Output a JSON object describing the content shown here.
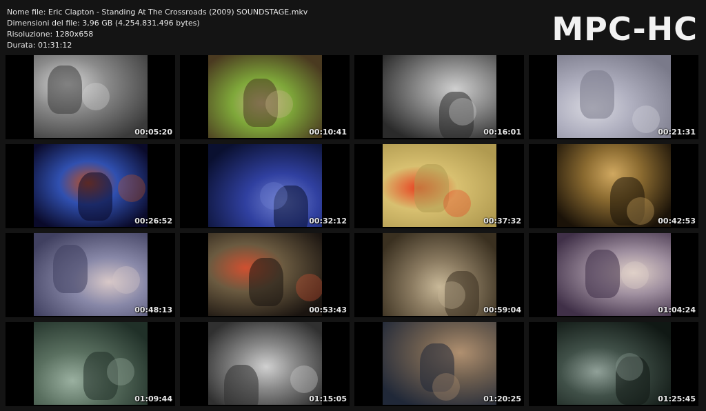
{
  "file_info": {
    "name_line": "Nome file: Eric Clapton - Standing At The Crossroads (2009) SOUNDSTAGE.mkv",
    "size_line": "Dimensioni del file: 3,96 GB (4.254.831.496 bytes)",
    "resolution_line": "Risoluzione: 1280x658",
    "duration_line": "Durata: 01:31:12"
  },
  "logo": "MPC-HC",
  "thumbnails": [
    {
      "time": "00:05:20",
      "colors": [
        "#3a3a3a",
        "#8a8a8a",
        "#d8d8d8"
      ]
    },
    {
      "time": "00:10:41",
      "colors": [
        "#4a3a20",
        "#7fa83a",
        "#c9b48a"
      ]
    },
    {
      "time": "00:16:01",
      "colors": [
        "#2a2a2a",
        "#8c8c8c",
        "#cfcfcf"
      ]
    },
    {
      "time": "00:21:31",
      "colors": [
        "#7a7a8a",
        "#b0b0c0",
        "#d8d8e0"
      ]
    },
    {
      "time": "00:26:52",
      "colors": [
        "#0a0a2a",
        "#3050b0",
        "#c05020"
      ]
    },
    {
      "time": "00:32:12",
      "colors": [
        "#0a1030",
        "#3040a0",
        "#7080d0"
      ]
    },
    {
      "time": "00:37:32",
      "colors": [
        "#b09a50",
        "#d8c070",
        "#e84020"
      ]
    },
    {
      "time": "00:42:53",
      "colors": [
        "#1a1208",
        "#8a6a30",
        "#d0a860"
      ]
    },
    {
      "time": "00:48:13",
      "colors": [
        "#404060",
        "#8888a8",
        "#d8c8c8"
      ]
    },
    {
      "time": "00:53:43",
      "colors": [
        "#1a1410",
        "#6a5a40",
        "#d05030"
      ]
    },
    {
      "time": "00:59:04",
      "colors": [
        "#3a3020",
        "#8a7a60",
        "#c8b898"
      ]
    },
    {
      "time": "01:04:24",
      "colors": [
        "#403048",
        "#a090a0",
        "#e0d0c8"
      ]
    },
    {
      "time": "01:09:44",
      "colors": [
        "#203028",
        "#5a7060",
        "#9ab0a0"
      ]
    },
    {
      "time": "01:15:05",
      "colors": [
        "#303030",
        "#8a8a8a",
        "#d0d0d0"
      ]
    },
    {
      "time": "01:20:25",
      "colors": [
        "#202838",
        "#706050",
        "#b09070"
      ]
    },
    {
      "time": "01:25:45",
      "colors": [
        "#101814",
        "#405048",
        "#90a098"
      ]
    }
  ]
}
